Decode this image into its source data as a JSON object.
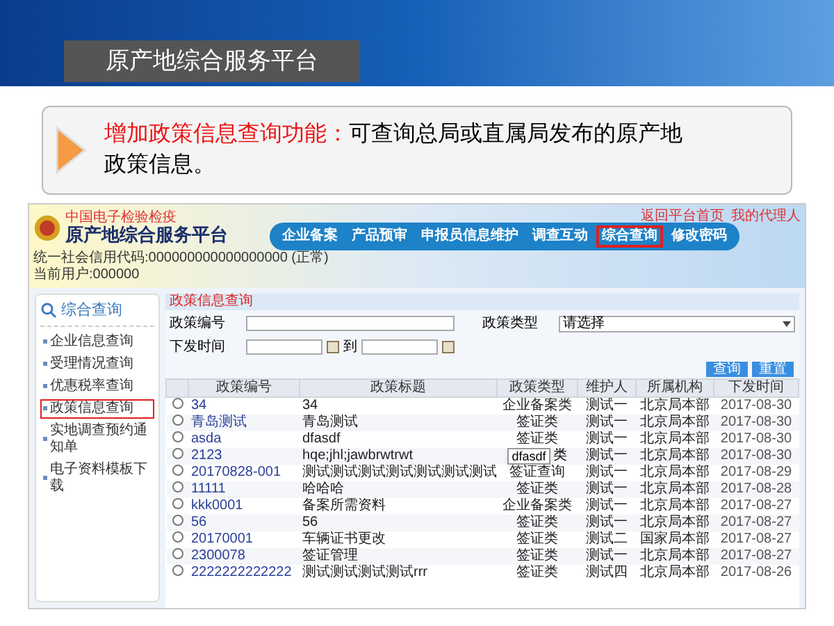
{
  "slide": {
    "title": "原产地综合服务平台",
    "callout": {
      "highlight": "增加政策信息查询功能：",
      "text": "可查询总局或直属局发布的原产地政策信息。"
    }
  },
  "app": {
    "org_label": "中国电子检验检疫",
    "title": "原产地综合服务平台",
    "credit_code": "统一社会信用代码:000000000000000000 (正常)",
    "current_user": "当前用户:000000",
    "nav": [
      {
        "label": "企业备案",
        "selected": false
      },
      {
        "label": "产品预审",
        "selected": false
      },
      {
        "label": "申报员信息维护",
        "selected": false
      },
      {
        "label": "调查互动",
        "selected": false
      },
      {
        "label": "综合查询",
        "selected": true
      },
      {
        "label": "修改密码",
        "selected": false
      }
    ],
    "top_links": [
      "返回平台首页",
      "我的代理人"
    ],
    "sidebar": {
      "title": "综合查询",
      "items": [
        {
          "label": "企业信息查询",
          "selected": false
        },
        {
          "label": "受理情况查询",
          "selected": false
        },
        {
          "label": "优惠税率查询",
          "selected": false
        },
        {
          "label": "政策信息查询",
          "selected": true
        },
        {
          "label": "实地调查预约通知单",
          "selected": false
        },
        {
          "label": "电子资料模板下载",
          "selected": false
        }
      ]
    },
    "panel": {
      "title": "政策信息查询",
      "fields": {
        "number_label": "政策编号",
        "type_label": "政策类型",
        "type_value": "请选择",
        "date_label": "下发时间",
        "date_sep": "到"
      },
      "buttons": [
        "查询",
        "重置"
      ],
      "table": {
        "columns": [
          "政策编号",
          "政策标题",
          "政策类型",
          "维护人",
          "所属机构",
          "下发时间"
        ],
        "rows": [
          {
            "selected": false,
            "cells": [
              "34",
              "34",
              "企业备案类",
              "测试一",
              "北京局本部",
              "2017-08-30"
            ]
          },
          {
            "selected": false,
            "cells": [
              "青岛测试",
              "青岛测试",
              "签证类",
              "测试一",
              "北京局本部",
              "2017-08-30"
            ]
          },
          {
            "selected": false,
            "cells": [
              "asda",
              "dfasdf",
              "签证类",
              "测试一",
              "北京局本部",
              "2017-08-30"
            ]
          },
          {
            "selected": false,
            "cells": [
              "2123",
              "hqe;jhl;jawbrwtrwt",
              "类",
              "测试一",
              "北京局本部",
              "2017-08-30"
            ],
            "tooltip": "dfasdf"
          },
          {
            "selected": false,
            "cells": [
              "20170828-001",
              "测试测试测试测试测试测试测试",
              "签证查询",
              "测试一",
              "北京局本部",
              "2017-08-29"
            ]
          },
          {
            "selected": false,
            "cells": [
              "11111",
              "哈哈哈",
              "签证类",
              "测试一",
              "北京局本部",
              "2017-08-28"
            ]
          },
          {
            "selected": false,
            "cells": [
              "kkk0001",
              "备案所需资料",
              "企业备案类",
              "测试一",
              "北京局本部",
              "2017-08-27"
            ]
          },
          {
            "selected": false,
            "cells": [
              "56",
              "56",
              "签证类",
              "测试一",
              "北京局本部",
              "2017-08-27"
            ]
          },
          {
            "selected": false,
            "cells": [
              "20170001",
              "车辆证书更改",
              "签证类",
              "测试二",
              "国家局本部",
              "2017-08-27"
            ]
          },
          {
            "selected": false,
            "cells": [
              "2300078",
              "签证管理",
              "签证类",
              "测试一",
              "北京局本部",
              "2017-08-27"
            ]
          },
          {
            "selected": false,
            "cells": [
              "2222222222222",
              "测试测试测试测试rrr",
              "签证类",
              "测试四",
              "北京局本部",
              "2017-08-26"
            ]
          }
        ]
      }
    }
  }
}
